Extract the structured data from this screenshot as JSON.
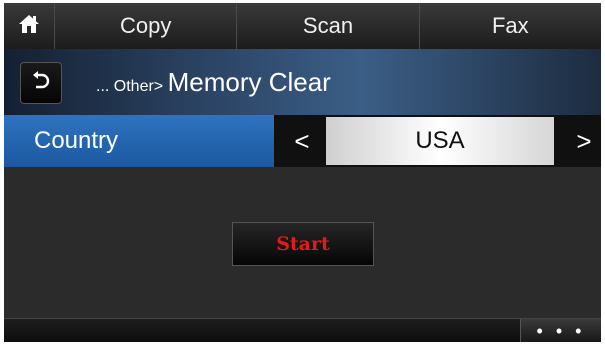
{
  "tabs": {
    "home_icon": "home-icon",
    "items": [
      {
        "label": "Copy"
      },
      {
        "label": "Scan"
      },
      {
        "label": "Fax"
      }
    ]
  },
  "header": {
    "back_icon": "back-arrow-icon",
    "breadcrumb_prefix": "... Other>",
    "title": "Memory Clear"
  },
  "setting": {
    "label": "Country",
    "prev_symbol": "<",
    "value": "USA",
    "next_symbol": ">"
  },
  "actions": {
    "start_label": "Start"
  },
  "footer": {
    "more_label": "• • •"
  },
  "colors": {
    "accent_blue": "#2f73c0",
    "start_red": "#e11a1a"
  }
}
